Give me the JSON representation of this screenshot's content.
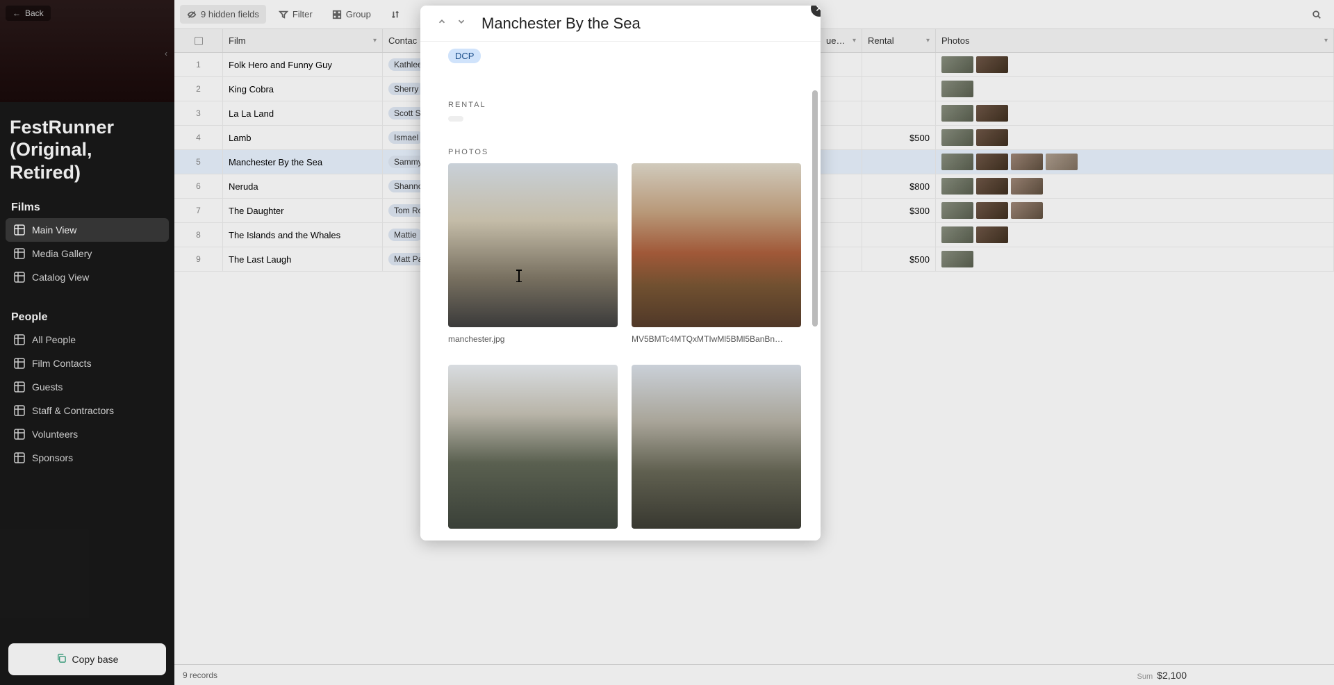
{
  "sidebar": {
    "back_label": "Back",
    "base_title": "FestRunner (Original, Retired)",
    "section_films": "Films",
    "section_people": "People",
    "films_views": [
      {
        "label": "Main View"
      },
      {
        "label": "Media Gallery"
      },
      {
        "label": "Catalog View"
      }
    ],
    "people_views": [
      {
        "label": "All People"
      },
      {
        "label": "Film Contacts"
      },
      {
        "label": "Guests"
      },
      {
        "label": "Staff & Contractors"
      },
      {
        "label": "Volunteers"
      },
      {
        "label": "Sponsors"
      }
    ],
    "copy_base_label": "Copy base"
  },
  "toolbar": {
    "hidden_fields": "9 hidden fields",
    "filter": "Filter",
    "group": "Group"
  },
  "columns": {
    "film": "Film",
    "contact": "Contac",
    "queue": "ue…",
    "rental": "Rental",
    "photos": "Photos"
  },
  "rows": [
    {
      "n": "1",
      "film": "Folk Hero and Funny Guy",
      "contact": "Kathlee",
      "rental": "",
      "thumbs": 2
    },
    {
      "n": "2",
      "film": "King Cobra",
      "contact": "Sherry",
      "rental": "",
      "thumbs": 1
    },
    {
      "n": "3",
      "film": "La La Land",
      "contact": "Scott S",
      "rental": "",
      "thumbs": 2
    },
    {
      "n": "4",
      "film": "Lamb",
      "contact": "Ismael",
      "rental": "$500",
      "thumbs": 2
    },
    {
      "n": "5",
      "film": "Manchester By the Sea",
      "contact": "Sammy",
      "rental": "",
      "thumbs": 4
    },
    {
      "n": "6",
      "film": "Neruda",
      "contact": "Shanno",
      "rental": "$800",
      "thumbs": 3
    },
    {
      "n": "7",
      "film": "The Daughter",
      "contact": "Tom Ro",
      "rental": "$300",
      "thumbs": 3
    },
    {
      "n": "8",
      "film": "The Islands and the Whales",
      "contact": "Mattie",
      "rental": "",
      "thumbs": 2
    },
    {
      "n": "9",
      "film": "The Last Laugh",
      "contact": "Matt Pa",
      "rental": "$500",
      "thumbs": 1
    }
  ],
  "footer": {
    "records": "9 records",
    "sum_label": "Sum",
    "sum_value": "$2,100"
  },
  "modal": {
    "title": "Manchester By the Sea",
    "tag": "DCP",
    "rental_label": "RENTAL",
    "photos_label": "PHOTOS",
    "photos": [
      {
        "name": "manchester.jpg"
      },
      {
        "name": "MV5BMTc4MTQxMTIwMl5BMl5BanBn…"
      },
      {
        "name": ""
      },
      {
        "name": ""
      }
    ]
  }
}
